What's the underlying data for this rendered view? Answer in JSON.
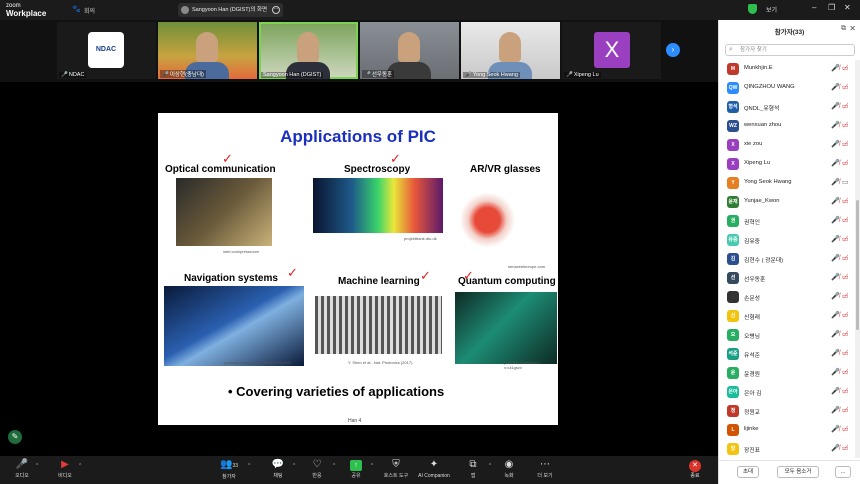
{
  "app": {
    "brand_top": "zoom",
    "brand_bottom": "Workplace",
    "meeting_label": "회의"
  },
  "share": {
    "label": "Sangyoon Han (DGIST)의 화면"
  },
  "window": {
    "view_label": "보기"
  },
  "gallery": [
    {
      "name": "NDAC",
      "logo": "NDAC"
    },
    {
      "name": "이상현(충남대)"
    },
    {
      "name": "Sangyoon Han (DGIST)"
    },
    {
      "name": "선우동훈"
    },
    {
      "name": "Yong Seok Hwang"
    },
    {
      "name": "Xipeng Lu",
      "avatar": "X"
    }
  ],
  "slide": {
    "title": "Applications of PIC",
    "items": [
      {
        "caption": "Optical communication",
        "source": "intel.com/pressroom"
      },
      {
        "caption": "Spectroscopy",
        "source": "projektbank.dtu.dk"
      },
      {
        "caption": "AR/VR glasses",
        "source": "senseeeleurope.com"
      },
      {
        "caption": "Navigation systems",
        "source": "youtube.com/watch?v=aEqVEWg3NtI"
      },
      {
        "caption": "Machine learning",
        "source": "Y. Shen et al., Nat. Photonics (2017)"
      },
      {
        "caption": "Quantum computing",
        "source": "youtube.com/watch?v=ul1gsvv"
      }
    ],
    "bullet": "• Covering varieties of applications",
    "footer": "Han 4"
  },
  "toolbar": {
    "audio": "오디오",
    "video": "비디오",
    "participants": "참가자",
    "participants_count": "33",
    "chat": "채팅",
    "react": "반응",
    "share": "공유",
    "host_tools": "호스트 도구",
    "ai": "AI Companion",
    "apps": "앱",
    "record": "녹화",
    "more": "더 보기",
    "end": "종료"
  },
  "panel": {
    "title": "참가자(33)",
    "search_placeholder": "참가자 찾기",
    "participants": [
      {
        "name": "Munkhjin.E",
        "initial": "M",
        "color": "#c0392b",
        "camera_on": false
      },
      {
        "name": "QINGZHOU WANG",
        "initial": "QW",
        "color": "#2d8cff",
        "camera_on": false
      },
      {
        "name": "QNDL_유형석",
        "initial": "형석",
        "color": "#1e5fa8",
        "camera_on": false
      },
      {
        "name": "wenxuan zhou",
        "initial": "WZ",
        "color": "#2c4f8f",
        "camera_on": false
      },
      {
        "name": "xie zou",
        "initial": "X",
        "color": "#9b3fc1",
        "camera_on": false
      },
      {
        "name": "Xipeng Lu",
        "initial": "X",
        "color": "#9b3fc1",
        "camera_on": false
      },
      {
        "name": "Yong Seok Hwang",
        "initial": "Y",
        "color": "#e67e22",
        "camera_on": true
      },
      {
        "name": "Yunjae_Kwon",
        "initial": "윤재",
        "color": "#2e7d32",
        "camera_on": false
      },
      {
        "name": "권혁인",
        "initial": "권",
        "color": "#27ae60",
        "camera_on": false
      },
      {
        "name": "김유중",
        "initial": "유중",
        "color": "#48c9b0",
        "camera_on": false
      },
      {
        "name": "김현수 ( 광운대)",
        "initial": "김",
        "color": "#2c4f8f",
        "camera_on": false
      },
      {
        "name": "선우동훈",
        "initial": "선",
        "color": "#34495e",
        "camera_on": false
      },
      {
        "name": "손문성",
        "initial": "",
        "color": "#333333",
        "camera_on": false
      },
      {
        "name": "신형래",
        "initial": "신",
        "color": "#f1c40f",
        "camera_on": false
      },
      {
        "name": "오병님",
        "initial": "오",
        "color": "#27ae60",
        "camera_on": false
      },
      {
        "name": "유석준",
        "initial": "석준",
        "color": "#16a085",
        "camera_on": false
      },
      {
        "name": "윤경원",
        "initial": "윤",
        "color": "#27ae60",
        "camera_on": false
      },
      {
        "name": "은아 김",
        "initial": "은아",
        "color": "#1abc9c",
        "camera_on": false
      },
      {
        "name": "정원교",
        "initial": "정",
        "color": "#c0392b",
        "camera_on": false
      },
      {
        "name": "lijinke",
        "initial": "L",
        "color": "#d35400",
        "camera_on": false
      },
      {
        "name": "장진표",
        "initial": "장",
        "color": "#f1c40f",
        "camera_on": false
      }
    ],
    "invite": "초대",
    "mute_all": "모두 음소거",
    "more": "..."
  }
}
